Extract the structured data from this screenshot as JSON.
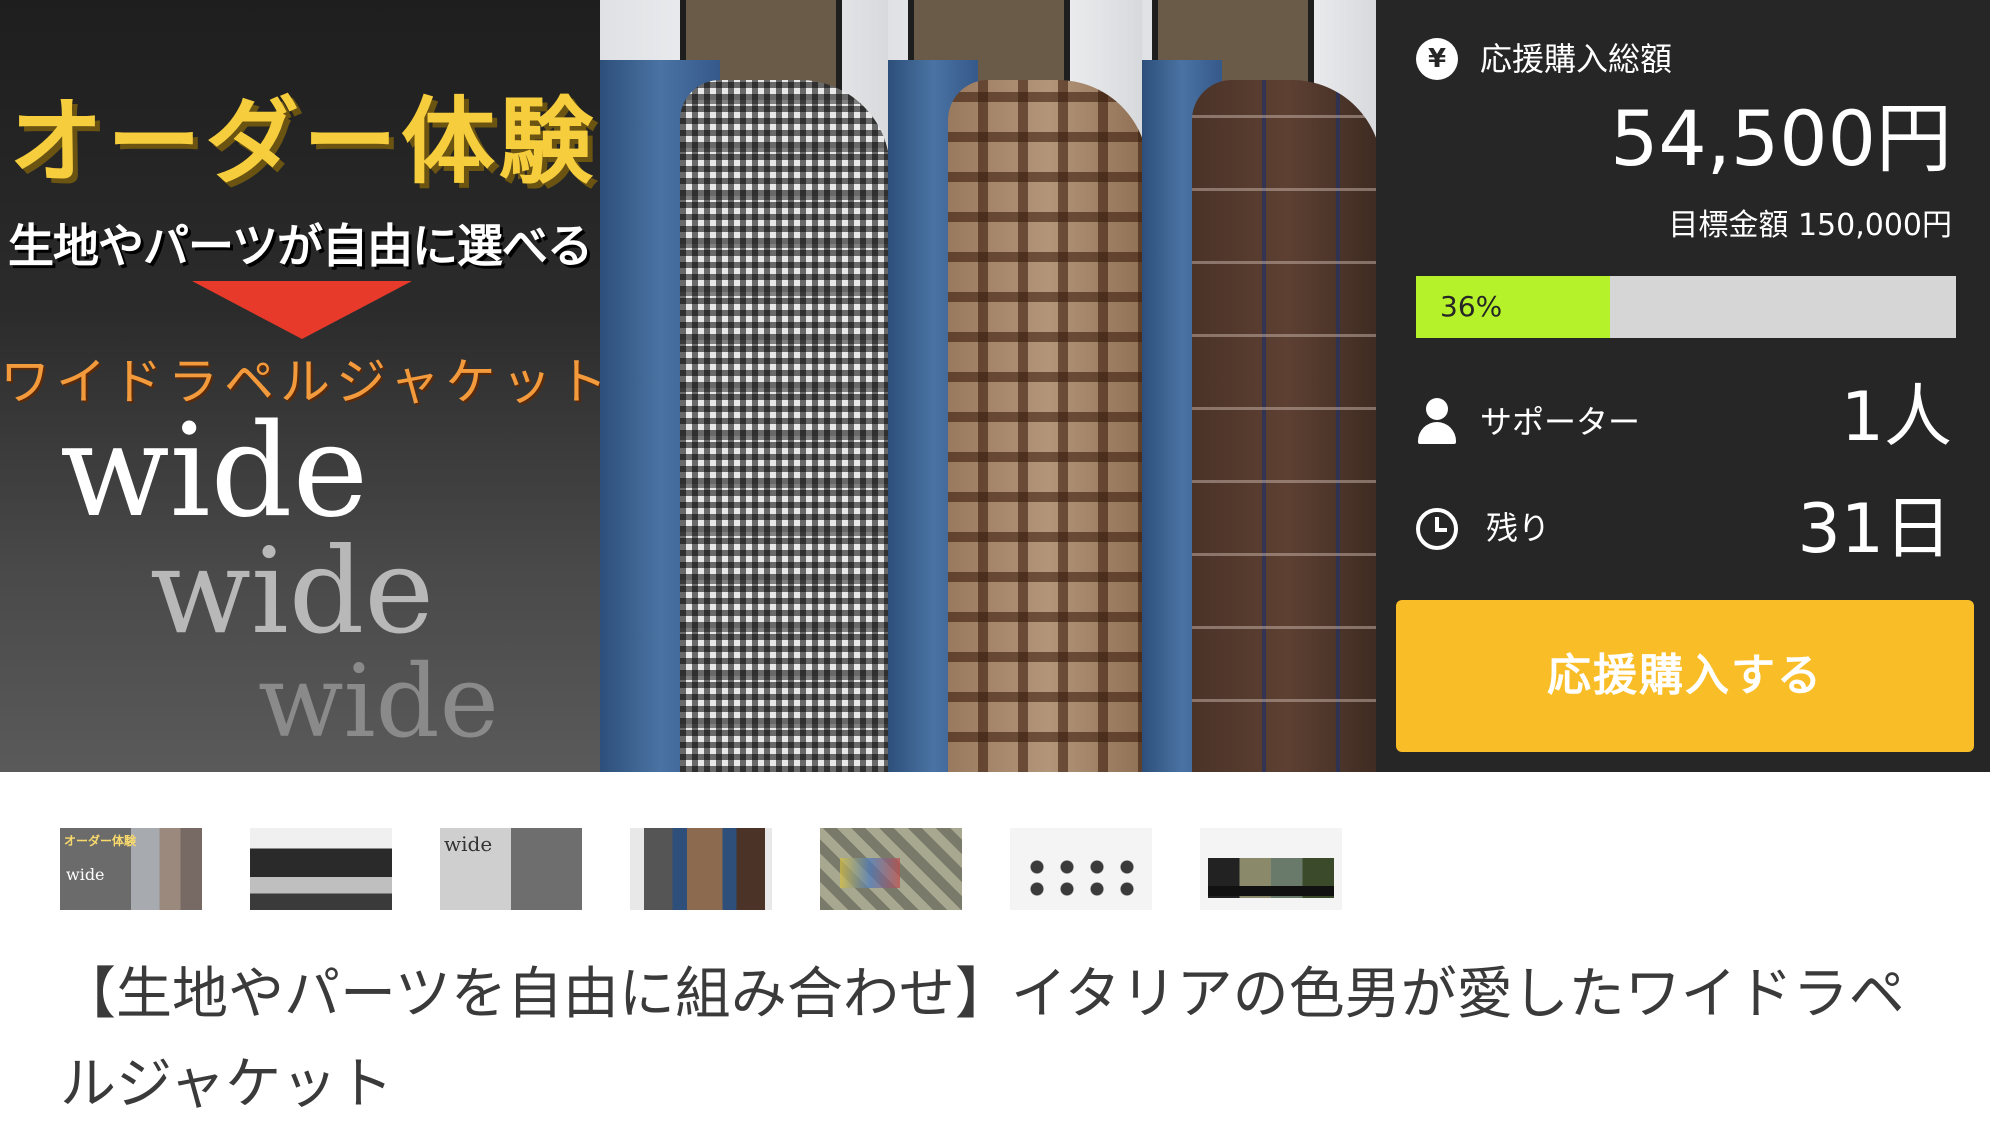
{
  "hero": {
    "headline": "オーダー体験",
    "subline": "生地やパーツが自由に選べる",
    "katakana": "ワイドラペルジャケット",
    "wide_words": [
      "wide",
      "wide",
      "wide"
    ]
  },
  "funding": {
    "raised_label": "応援購入総額",
    "raised_amount": "54,500円",
    "goal_text": "目標金額 150,000円",
    "progress_text": "36%",
    "progress_fraction": 0.36,
    "supporters_label": "サポーター",
    "supporters_value": "1人",
    "remaining_label": "残り",
    "remaining_value": "31日",
    "buy_button_label": "応援購入する",
    "colors": {
      "panel_bg": "#262626",
      "progress_fill": "#b6f22a",
      "button": "#f9bd28"
    }
  },
  "thumbnails": {
    "t1_title": "オーダー体験",
    "t1_wide": "wide",
    "t3_wide": "wide"
  },
  "project_title": "【生地やパーツを自由に組み合わせ】イタリアの色男が愛したワイドラペルジャケット"
}
